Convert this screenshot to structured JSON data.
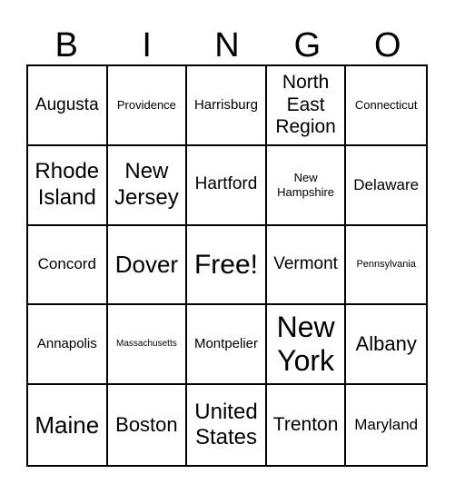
{
  "header": {
    "letters": [
      "B",
      "I",
      "N",
      "G",
      "O"
    ]
  },
  "cells": [
    {
      "text": "Augusta",
      "size": "l3"
    },
    {
      "text": "Providence",
      "size": "s2"
    },
    {
      "text": "Harrisburg",
      "size": "m1"
    },
    {
      "text": "North East Region",
      "size": "l4"
    },
    {
      "text": "Connecticut",
      "size": "s2"
    },
    {
      "text": "Rhode Island",
      "size": "xl1"
    },
    {
      "text": "New Jersey",
      "size": "xl1"
    },
    {
      "text": "Hartford",
      "size": "l3"
    },
    {
      "text": "New Hampshire",
      "size": "s2"
    },
    {
      "text": "Delaware",
      "size": "m2"
    },
    {
      "text": "Concord",
      "size": "m2"
    },
    {
      "text": "Dover",
      "size": "xl2"
    },
    {
      "text": "Free!",
      "size": "xl3"
    },
    {
      "text": "Vermont",
      "size": "l3"
    },
    {
      "text": "Pennsylvania",
      "size": "s1"
    },
    {
      "text": "Annapolis",
      "size": "m1"
    },
    {
      "text": "Massachusetts",
      "size": "xs"
    },
    {
      "text": "Montpelier",
      "size": "m1"
    },
    {
      "text": "New York",
      "size": "xxl"
    },
    {
      "text": "Albany",
      "size": "l5"
    },
    {
      "text": "Maine",
      "size": "xl2"
    },
    {
      "text": "Boston",
      "size": "l5"
    },
    {
      "text": "United States",
      "size": "xl1"
    },
    {
      "text": "Trenton",
      "size": "l4"
    },
    {
      "text": "Maryland",
      "size": "m2"
    }
  ]
}
